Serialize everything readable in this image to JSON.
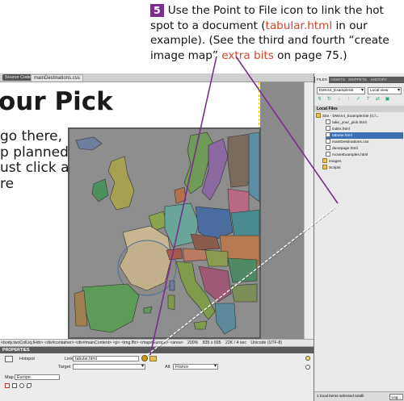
{
  "callout": {
    "step_number": "5",
    "text_1": "Use the Point to File icon to link the hot spot to a document (",
    "filename": "tabular.html",
    "text_2": " in our example). (See the third and fourth “create image map” ",
    "extra_bits": "extra bits",
    "text_3": " on page 75.)"
  },
  "doc_tabs": {
    "source_code": "Source Code",
    "css_file": "mainDestinations.css"
  },
  "design": {
    "title": "our Pick",
    "lines": [
      "go there,",
      "p planned",
      "ust click a",
      "re"
    ]
  },
  "status_bar": {
    "tag_selector": "<body.twoColLiq.tHdr> <div#container> <div#mainContent> <p> <img.fltr> <map#Europe> <area>",
    "zoom": "200%",
    "window_size": "835 x 695",
    "file_info": "22K / 4 sec",
    "encoding": "Unicode (UTF-8)"
  },
  "properties": {
    "header": "PROPERTIES",
    "hotspot_label": "Hotspot",
    "link_label": "Link",
    "link_value": "tabular.html",
    "target_label": "Target",
    "target_value": "",
    "alt_label": "Alt",
    "alt_value": "France",
    "map_label": "Map",
    "map_value": "Europe"
  },
  "files_panel": {
    "tabs": [
      "FILES",
      "ASSETS",
      "SNIPPETS",
      "HISTORY"
    ],
    "site_select": "DWcs4_ExampleSit",
    "view_select": "Local view",
    "local_files_header": "Local Files",
    "tree": [
      {
        "name": "Site - DWcs4_ExampleSite (C:\\...",
        "kind": "folder"
      },
      {
        "name": "take_your_pick.html",
        "kind": "file"
      },
      {
        "name": "index.html",
        "kind": "file"
      },
      {
        "name": "tabular.html",
        "kind": "file",
        "selected": true
      },
      {
        "name": "mainDestinations.css",
        "kind": "file"
      },
      {
        "name": "dunepage.html",
        "kind": "file"
      },
      {
        "name": "movieExamples.html",
        "kind": "file"
      },
      {
        "name": "images",
        "kind": "folder"
      },
      {
        "name": "Scripts",
        "kind": "folder"
      }
    ],
    "status": "1 local items selected totalli",
    "log_button": "Log..."
  },
  "colors": {
    "step_badge": "#7a2f8c",
    "highlight_text": "#d9442a",
    "arrow": "#7a2f8c",
    "map_ocean": "#8d8d8d"
  }
}
